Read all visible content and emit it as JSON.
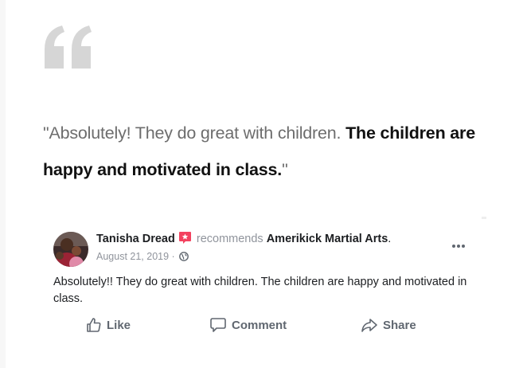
{
  "testimonial": {
    "open_quote": "\"",
    "normal_text": "Absolutely! They do great with children. ",
    "bold_text": "The children are happy and motivated in class.",
    "close_quote": "\""
  },
  "post": {
    "author": "Tanisha Dread",
    "recommends": "recommends",
    "page": "Amerikick Martial Arts",
    "page_suffix": ".",
    "date": "August 21, 2019",
    "date_sep": " · ",
    "body": "Absolutely!! They do great with children. The children are happy and motivated in class."
  },
  "actions": {
    "like": "Like",
    "comment": "Comment",
    "share": "Share"
  },
  "colors": {
    "quote_mark": "#d6d6d6",
    "recommend_badge": "#f3425f",
    "muted": "#90949c",
    "action": "#606770"
  }
}
